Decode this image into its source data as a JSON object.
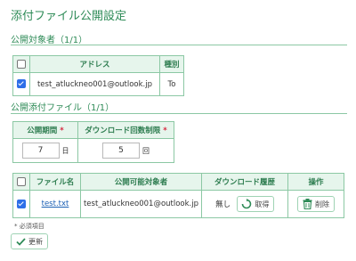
{
  "page": {
    "title": "添付ファイル公開設定"
  },
  "recipients": {
    "heading": "公開対象者（1/1）",
    "columns": [
      "",
      "アドレス",
      "種別"
    ],
    "rows": [
      {
        "checked": true,
        "address": "test_atluckneo001@outlook.jp",
        "type": "To"
      }
    ]
  },
  "files_section": {
    "heading": "公開添付ファイル（1/1）"
  },
  "settings": {
    "period_label": "公開期間",
    "limit_label": "ダウンロード回数制限",
    "required_mark": "*",
    "period_value": "7",
    "period_unit": "日",
    "limit_value": "5",
    "limit_unit": "回"
  },
  "files": {
    "columns": [
      "",
      "ファイル名",
      "公開可能対象者",
      "ダウンロード履歴",
      "操作"
    ],
    "rows": [
      {
        "checked": true,
        "filename": "test.txt",
        "target": "test_atluckneo001@outlook.jp",
        "history": "無し",
        "fetch_label": "取得",
        "delete_label": "削除"
      }
    ]
  },
  "footer": {
    "required_note": "* 必須項目",
    "update_label": "更新"
  },
  "colors": {
    "accent": "#2e8b57",
    "header_bg": "#e6f5ec",
    "border": "#8cc8a4",
    "link": "#1a5fb4",
    "required": "#d7263d"
  }
}
